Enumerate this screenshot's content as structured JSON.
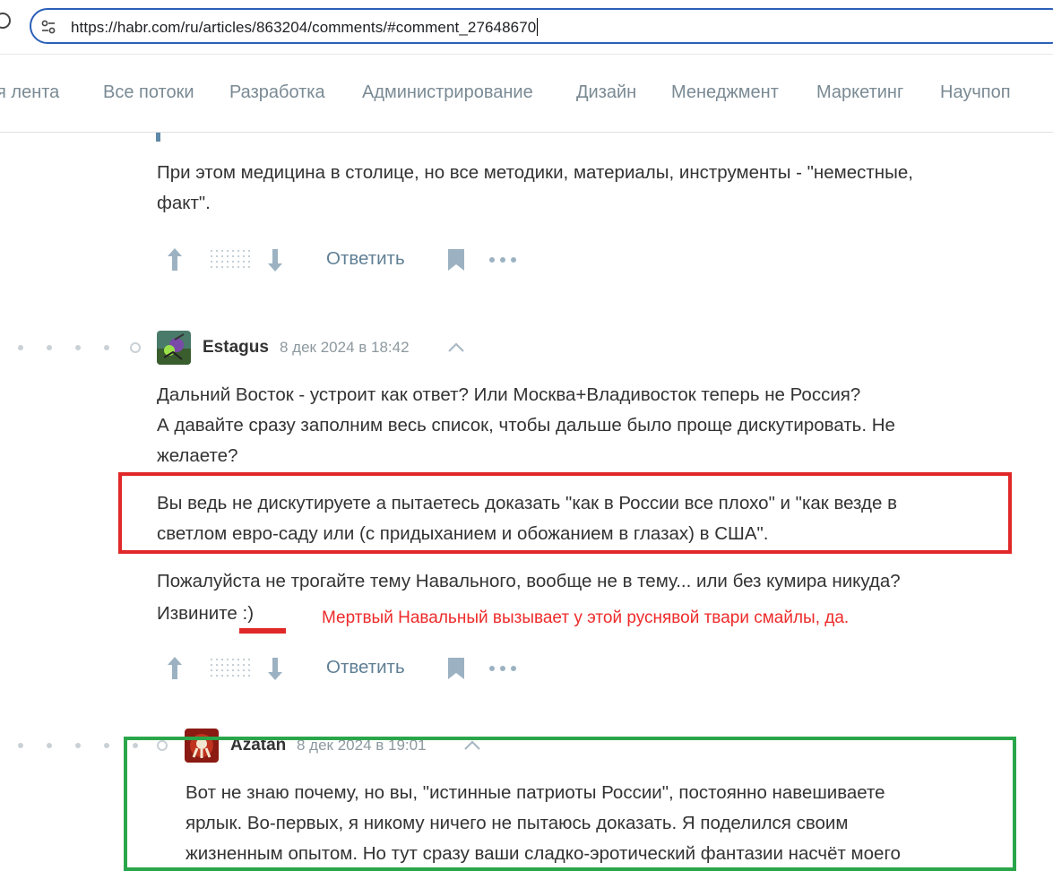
{
  "browser": {
    "url": "https://habr.com/ru/articles/863204/comments/#comment_27648670",
    "icons": {
      "reload": "reload-icon",
      "site_settings": "tune-icon"
    }
  },
  "nav": {
    "items": [
      "Моя лента",
      "Все потоки",
      "Разработка",
      "Администрирование",
      "Дизайн",
      "Менеджмент",
      "Маркетинг",
      "Научпоп"
    ],
    "item_color": "#7a8a94"
  },
  "comment_prev": {
    "lines": [
      "При этом медицина в столице, но все методики, материалы, инструменты - \"неместные,",
      "факт\"."
    ],
    "actions": {
      "reply_label": "Ответить"
    }
  },
  "comment_estagus": {
    "author": "Estagus",
    "timestamp": "8 дек 2024 в 18:42",
    "paragraphs": [
      "Дальний Восток - устроит как ответ? Или Москва+Владивосток теперь не Россия?",
      "А давайте сразу заполним весь список, чтобы дальше было проще дискутировать. Не",
      "желаете?",
      "Вы ведь не дискутируете а пытаетесь доказать \"как в России все плохо\" и \"как везде в",
      "светлом евро-саду или (с придыханием и обожанием в глазах) в США\".",
      "Пожалуйста не трогайте тему Навального, вообще не в тему... или без кумира никуда?",
      "Извините :)"
    ],
    "actions": {
      "reply_label": "Ответить"
    }
  },
  "comment_azatan": {
    "author": "Azatan",
    "timestamp": "8 дек 2024 в 19:01",
    "paragraphs": [
      "Вот не знаю почему, но вы, \"истинные патриоты России\", постоянно навешиваете",
      "ярлык. Во-первых, я никому ничего не пытаюсь доказать. Я поделился своим",
      "жизненным опытом. Но тут сразу ваши сладко-эротический фантазии насчёт моего"
    ]
  },
  "annotations": {
    "red_note": "Мертвый Навальный вызывает у этой руснявой твари смайлы, да.",
    "red_color": "#e02828",
    "green_color": "#2aa64a"
  },
  "colors": {
    "link": "#5f7f94",
    "meta": "#8d999f",
    "text": "#333333"
  }
}
